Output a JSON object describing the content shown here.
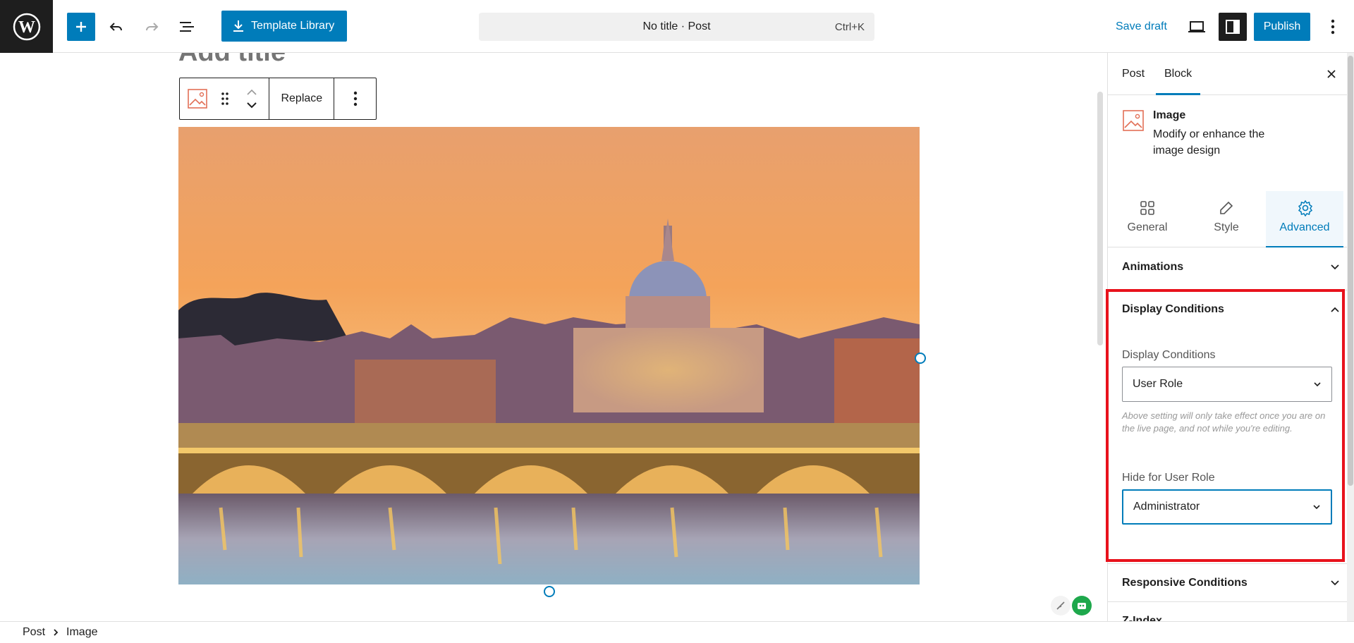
{
  "topbar": {
    "template_library_label": "Template Library",
    "command_title": "No title · Post",
    "command_shortcut": "Ctrl+K",
    "save_draft_label": "Save draft",
    "publish_label": "Publish"
  },
  "editor": {
    "title_placeholder": "Add title",
    "toolbar_replace_label": "Replace"
  },
  "breadcrumb": {
    "items": [
      "Post",
      "Image"
    ]
  },
  "sidebar": {
    "tabs": [
      "Post",
      "Block"
    ],
    "active_tab": "Block",
    "block_card": {
      "name": "Image",
      "description": "Modify or enhance the image design"
    },
    "inspector_tabs": [
      {
        "label": "General",
        "icon": "grid-icon"
      },
      {
        "label": "Style",
        "icon": "pencil-icon"
      },
      {
        "label": "Advanced",
        "icon": "gear-icon"
      }
    ],
    "active_inspector_tab": "Advanced",
    "panels": {
      "animations": "Animations",
      "display_conditions": "Display Conditions",
      "responsive_conditions": "Responsive Conditions",
      "z_index": "Z-Index"
    },
    "display_conditions": {
      "field_label": "Display Conditions",
      "value": "User Role",
      "help": "Above setting will only take effect once you are on the live page, and not while you're editing.",
      "hide_label": "Hide for User Role",
      "hide_value": "Administrator"
    }
  },
  "colors": {
    "accent": "#007cba",
    "dark": "#1e1e1e",
    "highlight": "#e8121c"
  }
}
